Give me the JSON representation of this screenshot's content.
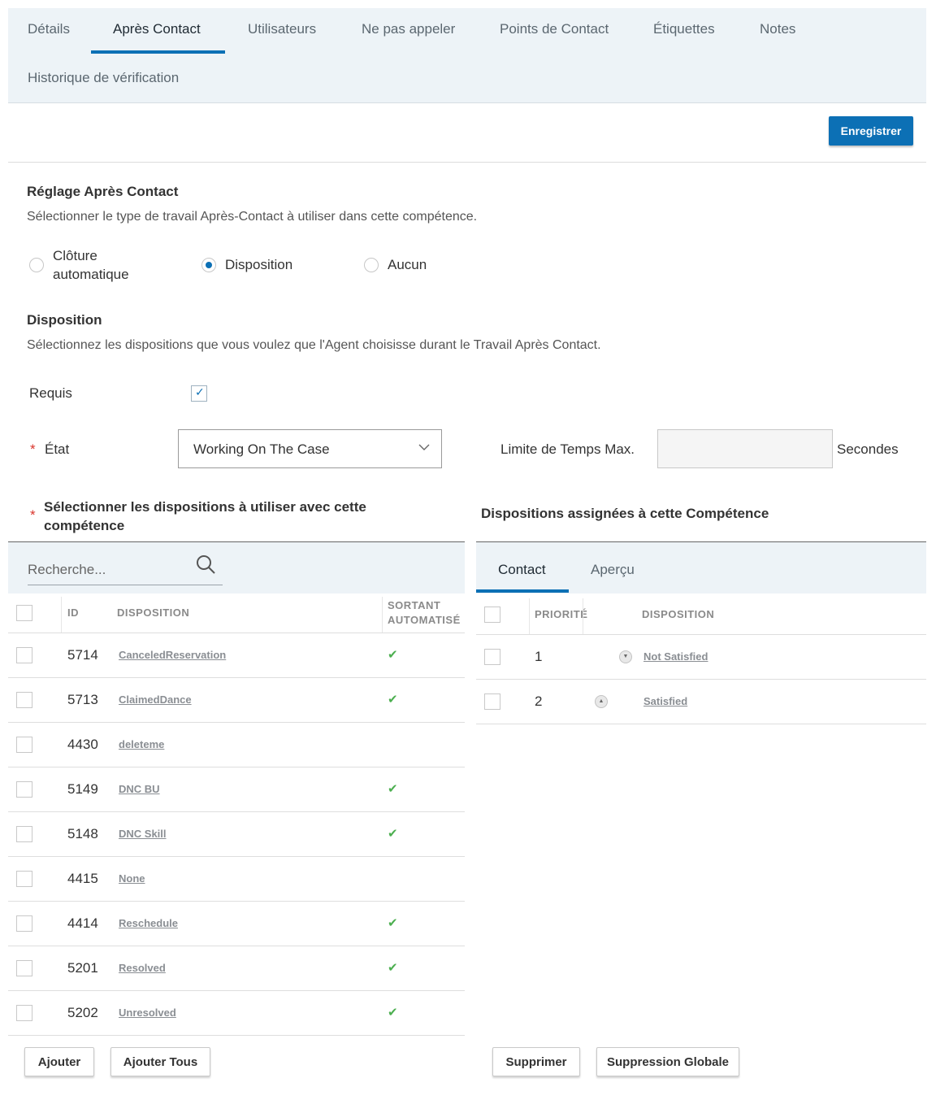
{
  "tabs": [
    {
      "label": "Détails"
    },
    {
      "label": "Après Contact",
      "active": true
    },
    {
      "label": "Utilisateurs"
    },
    {
      "label": "Ne pas appeler"
    },
    {
      "label": "Points de Contact"
    },
    {
      "label": "Étiquettes"
    },
    {
      "label": "Notes"
    },
    {
      "label": "Historique de vérification"
    }
  ],
  "toolbar": {
    "save_label": "Enregistrer"
  },
  "acw": {
    "title": "Réglage Après Contact",
    "description": "Sélectionner le type de travail Après-Contact à utiliser dans cette compétence.",
    "options": [
      {
        "label": "Clôture automatique",
        "label_line1": "Clôture",
        "label_line2": "automatique",
        "selected": false
      },
      {
        "label": "Disposition",
        "selected": true
      },
      {
        "label": "Aucun",
        "selected": false
      }
    ]
  },
  "disposition": {
    "title": "Disposition",
    "description": "Sélectionnez les dispositions que vous voulez que l'Agent choisisse durant le Travail Après Contact.",
    "required_label": "Requis",
    "required_checked": true,
    "state_label": "État",
    "state_required_marker": "*",
    "state_value": "Working On The Case",
    "max_time_label": "Limite de Temps Max.",
    "max_time_value": "",
    "max_time_unit": "Secondes"
  },
  "available": {
    "title_line1": "Sélectionner les dispositions à utiliser avec cette",
    "title_line2": "compétence",
    "required_marker": "*",
    "search_placeholder": "Recherche...",
    "headers": {
      "id": "ID",
      "disposition": "DISPOSITION",
      "auto_line1": "SORTANT",
      "auto_line2": "AUTOMATISÉ"
    },
    "rows": [
      {
        "id": "5714",
        "name": "CanceledReservation",
        "auto": true
      },
      {
        "id": "5713",
        "name": "ClaimedDance",
        "auto": true
      },
      {
        "id": "4430",
        "name": "deleteme",
        "auto": false
      },
      {
        "id": "5149",
        "name": "DNC BU",
        "auto": true
      },
      {
        "id": "5148",
        "name": "DNC Skill",
        "auto": true
      },
      {
        "id": "4415",
        "name": "None",
        "auto": false
      },
      {
        "id": "4414",
        "name": "Reschedule",
        "auto": true
      },
      {
        "id": "5201",
        "name": "Resolved",
        "auto": true
      },
      {
        "id": "5202",
        "name": "Unresolved",
        "auto": true
      }
    ],
    "add_label": "Ajouter",
    "add_all_label": "Ajouter Tous"
  },
  "assigned": {
    "title": "Dispositions assignées à cette Compétence",
    "tabs": [
      {
        "label": "Contact",
        "active": true
      },
      {
        "label": "Aperçu"
      }
    ],
    "headers": {
      "priority": "PRIORITÉ",
      "disposition": "DISPOSITION"
    },
    "rows": [
      {
        "priority": "1",
        "name": "Not Satisfied",
        "move": "down"
      },
      {
        "priority": "2",
        "name": "Satisfied",
        "move": "up"
      }
    ],
    "delete_label": "Supprimer",
    "delete_all_label": "Suppression Globale"
  },
  "colors": {
    "accent": "#0c70b5",
    "tab_bg": "#edf3f7",
    "required": "#d9342b",
    "check": "#4caf50"
  }
}
